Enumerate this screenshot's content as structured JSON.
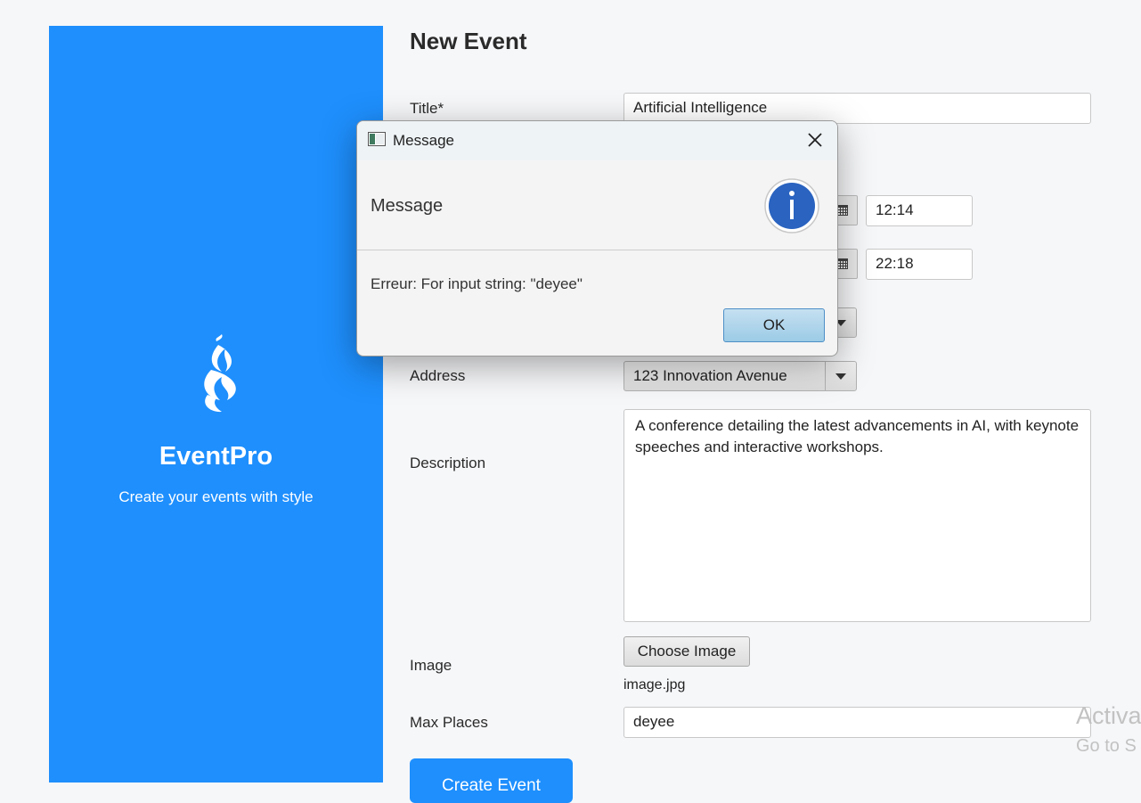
{
  "sidebar": {
    "brand": "EventPro",
    "tagline": "Create your events with style"
  },
  "form": {
    "heading": "New Event",
    "title_label": "Title*",
    "title_value": "Artificial Intelligence",
    "start_time": "12:14",
    "end_time": "22:18",
    "address_label": "Address",
    "address_value": "123 Innovation Avenue",
    "description_label": "Description",
    "description_value": "A conference detailing the latest advancements in AI, with keynote speeches and interactive workshops.",
    "image_label": "Image",
    "choose_image_label": "Choose Image",
    "image_file": "image.jpg",
    "max_places_label": "Max Places",
    "max_places_value": "deyee",
    "create_button": "Create Event"
  },
  "dialog": {
    "title": "Message",
    "header": "Message",
    "content": "Erreur: For input string: \"deyee\"",
    "ok": "OK"
  },
  "watermark": {
    "line1": "Activa",
    "line2": "Go to S"
  },
  "colors": {
    "accent": "#1e8ffd",
    "info_icon": "#2a63c0"
  }
}
